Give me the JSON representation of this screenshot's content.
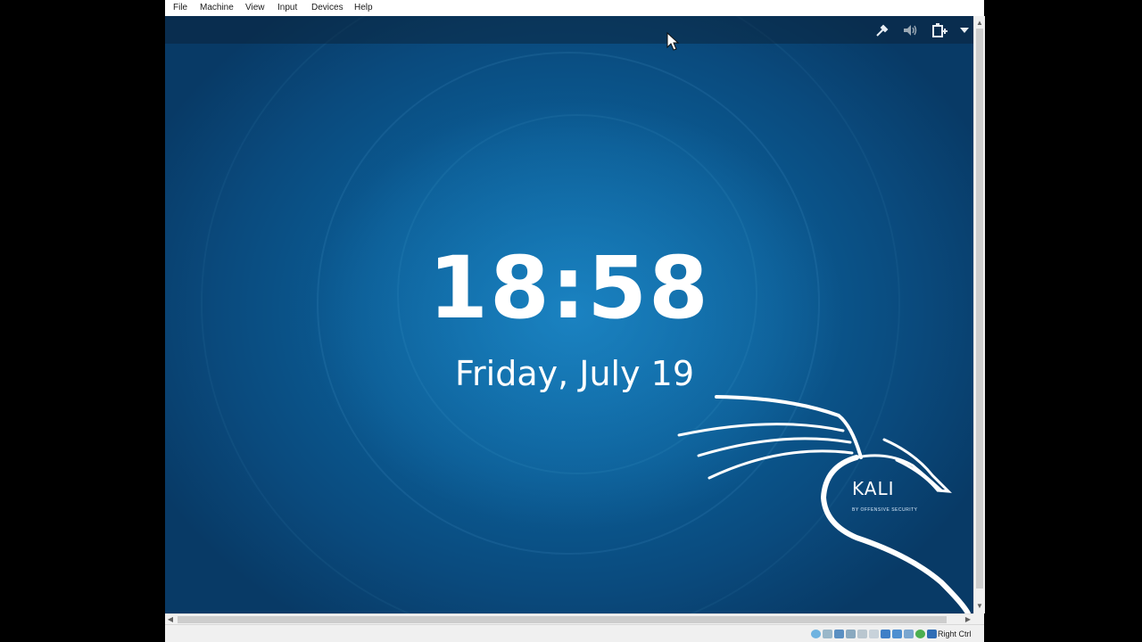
{
  "menubar": {
    "items": [
      {
        "label": "File"
      },
      {
        "label": "Machine"
      },
      {
        "label": "View"
      },
      {
        "label": "Input"
      },
      {
        "label": "Devices"
      },
      {
        "label": "Help"
      }
    ]
  },
  "lockscreen": {
    "time": "18:58",
    "date": "Friday, July 19"
  },
  "tray_icons": [
    "accessibility-icon",
    "volume-icon",
    "battery-icon",
    "dropdown-arrow-icon"
  ],
  "kali": {
    "logo_text": "KALI",
    "tagline": "BY OFFENSIVE SECURITY"
  },
  "statusbar": {
    "host_key": "Right Ctrl",
    "icons": [
      "hard-disk-icon",
      "optical-drive-icon",
      "audio-icon",
      "network-icon",
      "usb-icon",
      "shared-folders-icon",
      "display-icon",
      "video-capture-icon",
      "recording-icon",
      "cpu-icon",
      "mouse-integration-icon",
      "keyboard-icon"
    ]
  },
  "colors": {
    "wallpaper": "#0b5b93",
    "menubar_bg": "#ffffff",
    "statusbar_bg": "#f0f0f0"
  }
}
